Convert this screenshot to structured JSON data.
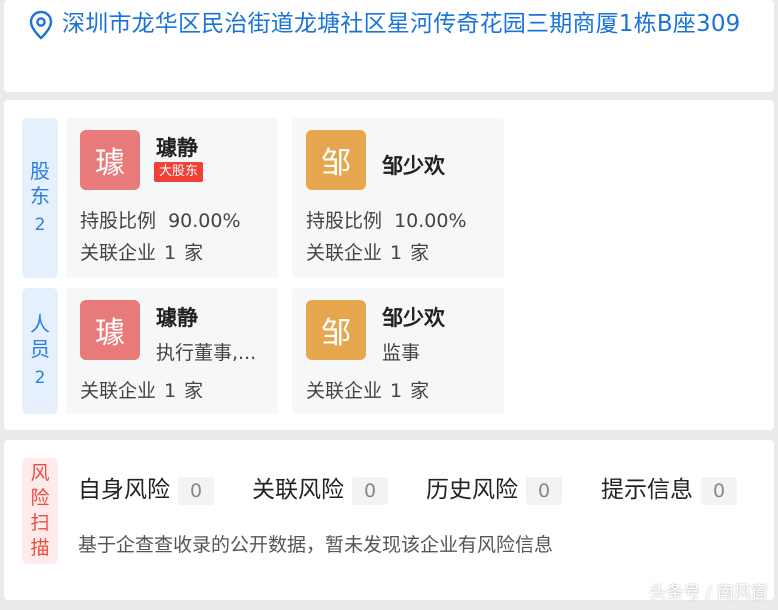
{
  "address": {
    "icon": "location-pin-icon",
    "text": "深圳市龙华区民治街道龙塘社区星河传奇花园三期商厦1栋B座309"
  },
  "shareholders": {
    "label_chars": [
      "股",
      "东"
    ],
    "count": "2",
    "items": [
      {
        "avatar_char": "璩",
        "avatar_color": "#e87a79",
        "name": "璩静",
        "badge": "大股东",
        "stake_label": "持股比例",
        "stake_value": "90.00%",
        "related_label": "关联企业",
        "related_count": "1",
        "related_unit": "家"
      },
      {
        "avatar_char": "邹",
        "avatar_color": "#e6a64e",
        "name": "邹少欢",
        "stake_label": "持股比例",
        "stake_value": "10.00%",
        "related_label": "关联企业",
        "related_count": "1",
        "related_unit": "家"
      }
    ]
  },
  "personnel": {
    "label_chars": [
      "人",
      "员"
    ],
    "count": "2",
    "items": [
      {
        "avatar_char": "璩",
        "avatar_color": "#e87a79",
        "name": "璩静",
        "role": "执行董事,...",
        "related_label": "关联企业",
        "related_count": "1",
        "related_unit": "家"
      },
      {
        "avatar_char": "邹",
        "avatar_color": "#e6a64e",
        "name": "邹少欢",
        "role": "监事",
        "related_label": "关联企业",
        "related_count": "1",
        "related_unit": "家"
      }
    ]
  },
  "risk": {
    "label_chars": [
      "风",
      "险",
      "扫",
      "描"
    ],
    "items": [
      {
        "label": "自身风险",
        "count": "0"
      },
      {
        "label": "关联风险",
        "count": "0"
      },
      {
        "label": "历史风险",
        "count": "0"
      },
      {
        "label": "提示信息",
        "count": "0"
      }
    ],
    "note": "基于企查查收录的公开数据，暂未发现该企业有风险信息"
  },
  "watermark": "头条号 / 南风窗"
}
